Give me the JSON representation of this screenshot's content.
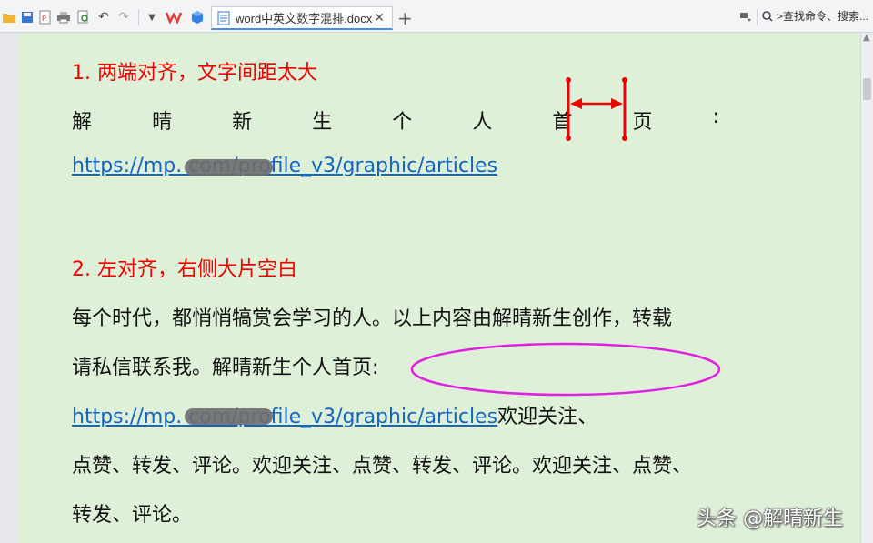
{
  "tab": {
    "title": "word中英文数字混排.docx",
    "close": "✕"
  },
  "toolbar": {
    "plus": "+",
    "search": ">查找命令、搜索..."
  },
  "content": {
    "heading1": "1. 两端对齐，文字间距太大",
    "spread_chars": [
      "解",
      "晴",
      "新",
      "生",
      "个",
      "人",
      "首",
      "页",
      ":"
    ],
    "link1": "https://mp.                com/profile_v3/graphic/articles",
    "heading2": "2. 左对齐，右侧大片空白",
    "para_line1": "每个时代，都悄悄犒赏会学习的人。以上内容由解晴新生创作，转载",
    "para_line2": "请私信联系我。解晴新生个人首页:",
    "link2": "https://mp.                com/profile_v3/graphic/articles",
    "link2_tail": "欢迎关注、",
    "para_line4": "点赞、转发、评论。欢迎关注、点赞、转发、评论。欢迎关注、点赞、",
    "para_line5": "转发、评论。"
  },
  "watermark": "头条 @解晴新生",
  "colors": {
    "page_bg": "#dff0d9",
    "heading": "#e00000",
    "link": "#1565c0",
    "annotation": "#e00000",
    "ellipse": "#e020e0"
  }
}
